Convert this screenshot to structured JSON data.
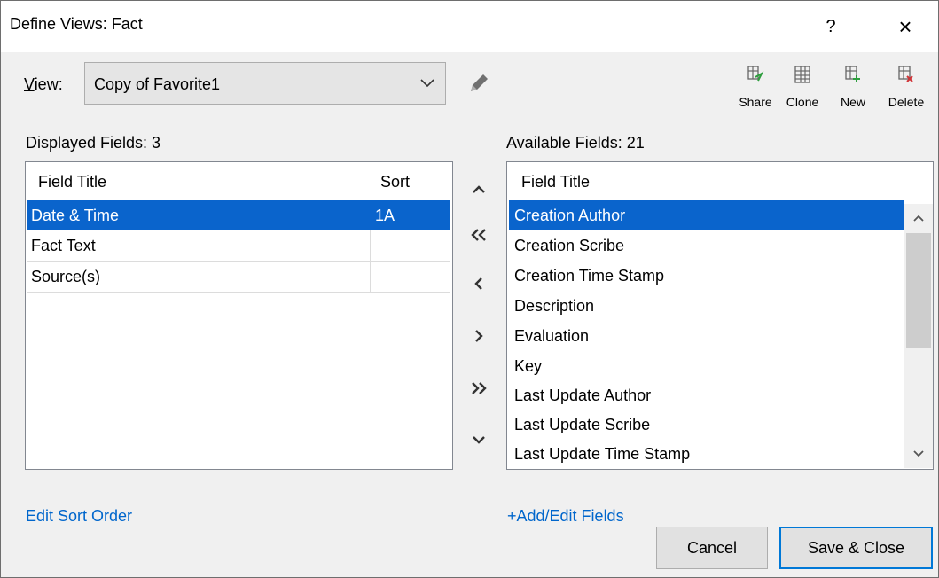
{
  "dialog": {
    "title": "Define Views: Fact",
    "help_label": "?",
    "close_label": "×"
  },
  "view": {
    "label_underlined": "V",
    "label_rest": "iew:",
    "selected": "Copy of Favorite1"
  },
  "toolbar": {
    "share": "Share",
    "clone": "Clone",
    "new": "New",
    "delete": "Delete"
  },
  "displayed": {
    "label": "Displayed Fields: 3",
    "headers": {
      "title": "Field Title",
      "sort": "Sort"
    },
    "rows": [
      {
        "title": "Date & Time",
        "sort": "1A",
        "selected": true
      },
      {
        "title": "Fact Text",
        "sort": "",
        "selected": false
      },
      {
        "title": "Source(s)",
        "sort": "",
        "selected": false
      }
    ]
  },
  "available": {
    "label": "Available Fields: 21",
    "header": "Field Title",
    "rows": [
      "Creation Author",
      "Creation Scribe",
      "Creation Time Stamp",
      "Description",
      "Evaluation",
      "Key",
      "Last Update Author",
      "Last Update Scribe",
      "Last Update Time Stamp"
    ]
  },
  "links": {
    "edit_sort": "Edit Sort Order",
    "add_edit_fields": "+Add/Edit Fields"
  },
  "buttons": {
    "cancel": "Cancel",
    "save_close": "Save & Close"
  },
  "colors": {
    "selection": "#0a64cc",
    "link": "#0066cc",
    "dialog_bg": "#f0f0f0"
  }
}
